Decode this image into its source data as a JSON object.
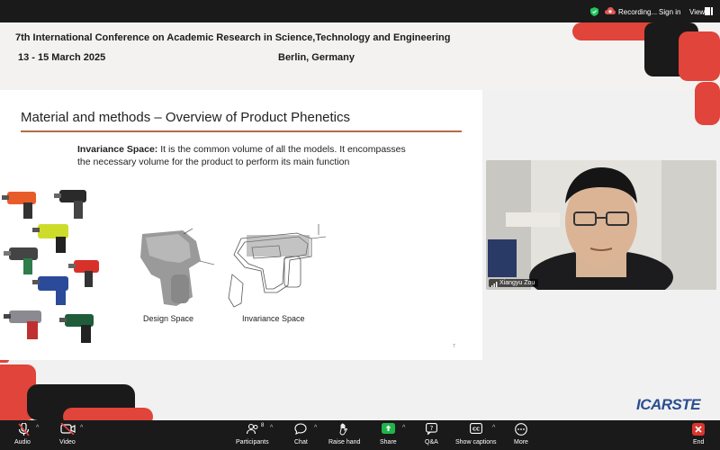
{
  "topbar": {
    "recording_label": "Recording...",
    "signin_label": "Sign in",
    "view_label": "View",
    "colors": {
      "shield": "#22c55e",
      "record": "#e25555"
    }
  },
  "banner": {
    "title": "7th International Conference on Academic Research in Science,Technology and Engineering",
    "dates": "13 - 15 March 2025",
    "city": "Berlin, Germany",
    "accent_color": "#e0443a"
  },
  "slide": {
    "title": "Material and methods – Overview of Product Phenetics",
    "desc_term": "Invariance Space:",
    "desc_line1": " It is the common volume of all the models. It encompasses",
    "desc_line2": "the necessary volume for the product to perform its main function",
    "label_design": "Design Space",
    "label_invariance": "Invariance Space",
    "page_number": "7"
  },
  "video": {
    "participant_name": "Xiangyu Zou"
  },
  "logo": {
    "text": "ICARSTE"
  },
  "toolbar": {
    "audio": "Audio",
    "video": "Video",
    "participants": "Participants",
    "participants_count": "8",
    "chat": "Chat",
    "raise_hand": "Raise hand",
    "share": "Share",
    "qa": "Q&A",
    "show_captions": "Show captions",
    "more": "More",
    "end": "End",
    "colors": {
      "share": "#20b44b",
      "end": "#d9362e",
      "muted": "#e8453c"
    }
  }
}
